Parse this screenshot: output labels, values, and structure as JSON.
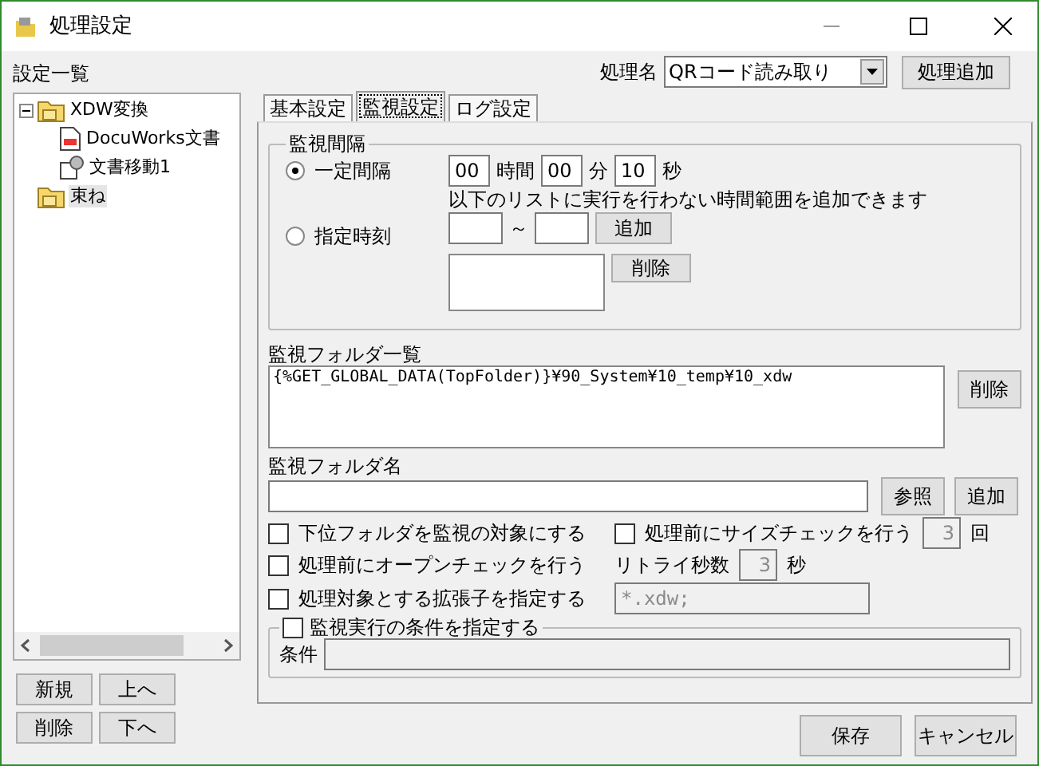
{
  "window": {
    "title": "処理設定"
  },
  "settings_list": {
    "label": "設定一覧",
    "tree": [
      {
        "label": "XDW変換",
        "kind": "folder",
        "expanded": true,
        "selected": false,
        "children": [
          {
            "label": "DocuWorks文書",
            "kind": "docuworks",
            "selected": false
          },
          {
            "label": "文書移動1",
            "kind": "move",
            "selected": false
          }
        ]
      },
      {
        "label": "束ね",
        "kind": "folder",
        "selected": true
      }
    ],
    "buttons": [
      "新規",
      "上へ",
      "削除",
      "下へ"
    ]
  },
  "process_name": {
    "label": "処理名",
    "value": "QRコード読み取り",
    "add_button": "処理追加"
  },
  "tabs": [
    {
      "label": "基本設定",
      "selected": false
    },
    {
      "label": "監視設定",
      "selected": true
    },
    {
      "label": "ログ設定",
      "selected": false
    }
  ],
  "interval": {
    "title": "監視間隔",
    "radios": [
      {
        "label": "一定間隔",
        "selected": true
      },
      {
        "label": "指定時刻",
        "selected": false
      }
    ],
    "hours": "00",
    "hours_unit": "時間",
    "minutes": "00",
    "minutes_unit": "分",
    "seconds": "10",
    "seconds_unit": "秒",
    "note": "以下のリストに実行を行わない時間範囲を追加できます",
    "range_separator": "～",
    "add_button": "追加",
    "delete_button": "削除"
  },
  "folder_list": {
    "label": "監視フォルダ一覧",
    "items": [
      "{%GET_GLOBAL_DATA(TopFolder)}¥90_System¥10_temp¥10_xdw"
    ],
    "delete_button": "削除"
  },
  "folder_name": {
    "label": "監視フォルダ名",
    "browse_button": "参照",
    "add_button": "追加"
  },
  "options": [
    {
      "label": "下位フォルダを監視の対象にする",
      "checked": false
    },
    {
      "label": "処理前にサイズチェックを行う",
      "checked": false,
      "value": "3",
      "unit": "回",
      "disabled": true
    },
    {
      "label": "処理前にオープンチェックを行う",
      "checked": false
    },
    {
      "label": "リトライ秒数",
      "value": "3",
      "unit": "秒",
      "disabled": true
    },
    {
      "label": "処理対象とする拡張子を指定する",
      "checked": false,
      "value": "*.xdw;",
      "disabled": true
    }
  ],
  "condition": {
    "title": "監視実行の条件を指定する",
    "checked": false,
    "label": "条件",
    "disabled": true
  },
  "footer_buttons": [
    "保存",
    "キャンセル"
  ]
}
